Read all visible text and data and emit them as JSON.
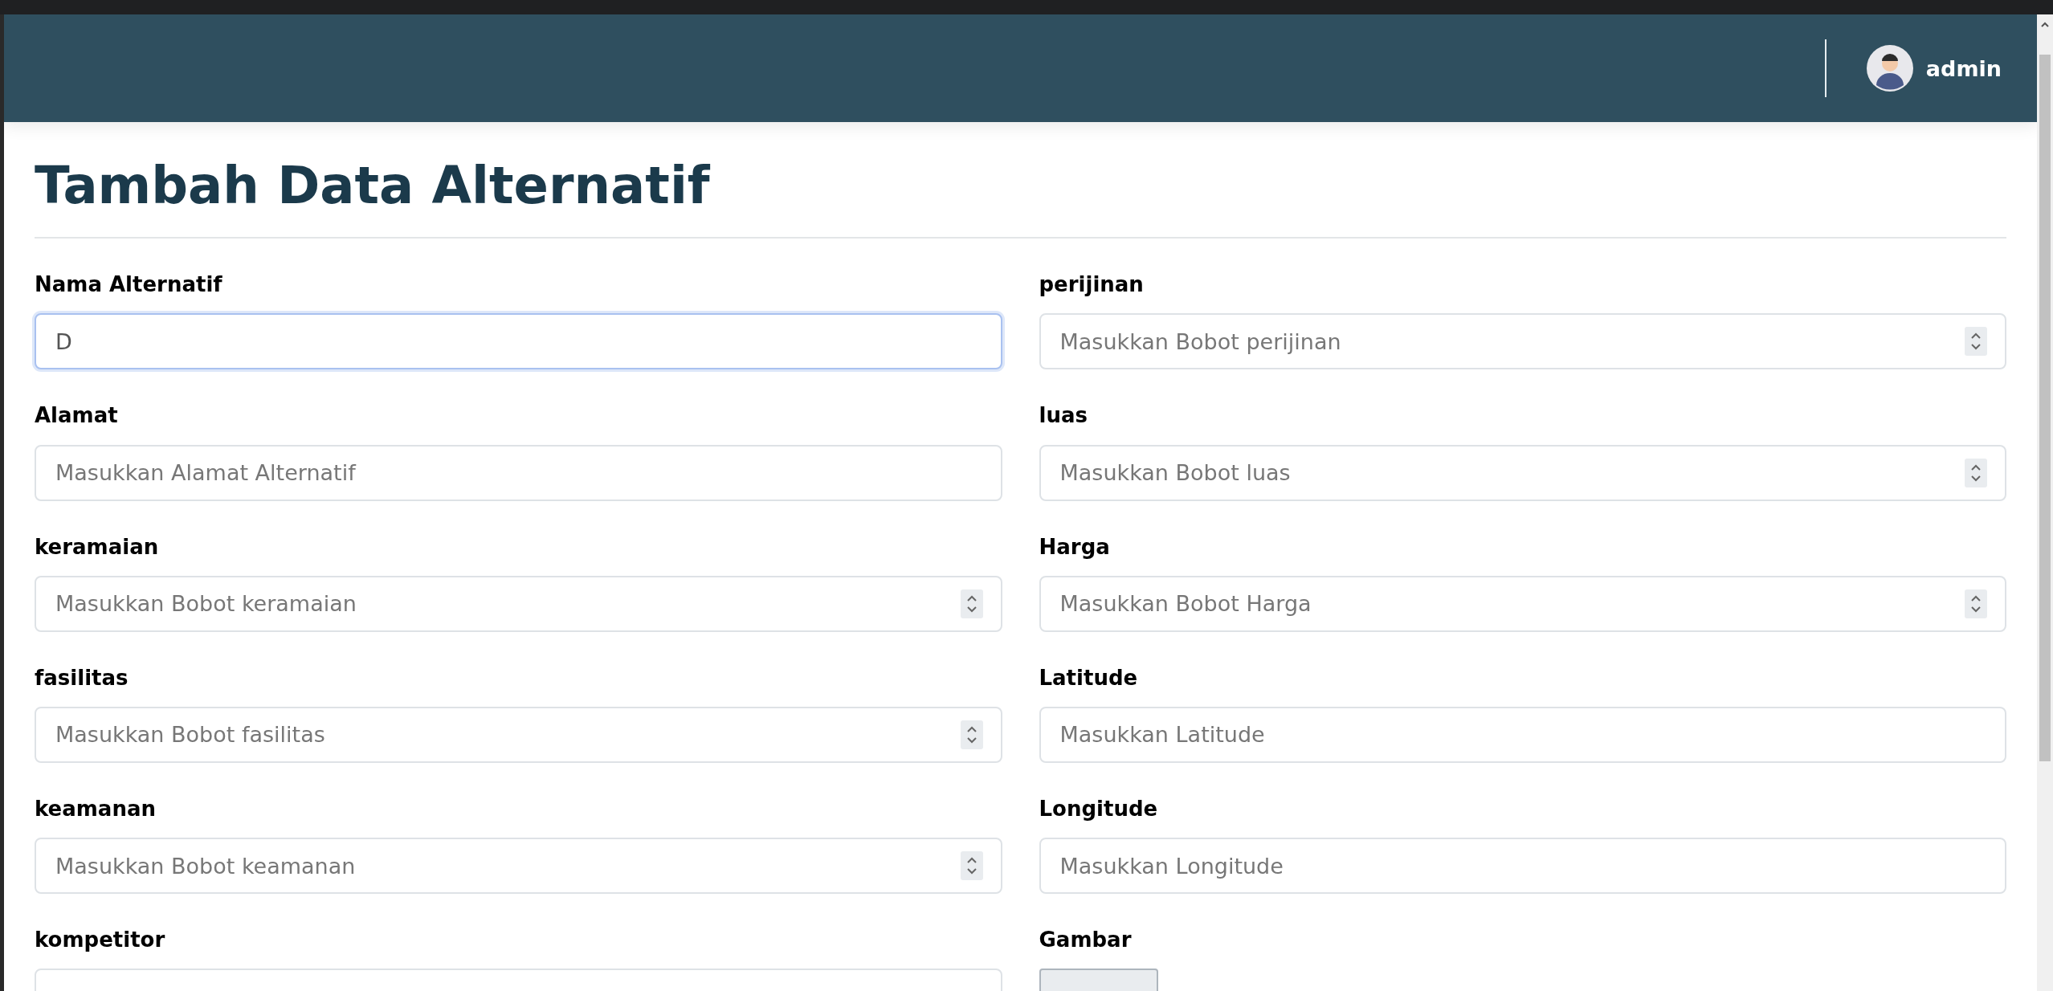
{
  "navbar": {
    "user": {
      "name": "admin"
    }
  },
  "page": {
    "title": "Tambah Data Alternatif"
  },
  "form": {
    "left": [
      {
        "label": "Nama Alternatif",
        "kind": "text",
        "value": "D",
        "focused": true
      },
      {
        "label": "Alamat",
        "kind": "text",
        "placeholder": "Masukkan Alamat Alternatif",
        "focused": false
      },
      {
        "label": "keramaian",
        "kind": "number",
        "placeholder": "Masukkan Bobot keramaian",
        "focused": false
      },
      {
        "label": "fasilitas",
        "kind": "number",
        "placeholder": "Masukkan Bobot fasilitas",
        "focused": false
      },
      {
        "label": "keamanan",
        "kind": "number",
        "placeholder": "Masukkan Bobot keamanan",
        "focused": false
      },
      {
        "label": "kompetitor",
        "kind": "text",
        "focused": false
      }
    ],
    "right": [
      {
        "label": "perijinan",
        "kind": "number",
        "placeholder": "Masukkan Bobot perijinan",
        "focused": false
      },
      {
        "label": "luas",
        "kind": "number",
        "placeholder": "Masukkan Bobot luas",
        "focused": false
      },
      {
        "label": "Harga",
        "kind": "number",
        "placeholder": "Masukkan Bobot Harga",
        "focused": false
      },
      {
        "label": "Latitude",
        "kind": "text",
        "placeholder": "Masukkan Latitude",
        "focused": false
      },
      {
        "label": "Longitude",
        "kind": "text",
        "placeholder": "Masukkan Longitude",
        "focused": false
      },
      {
        "label": "Gambar",
        "kind": "file",
        "focused": false
      }
    ]
  }
}
